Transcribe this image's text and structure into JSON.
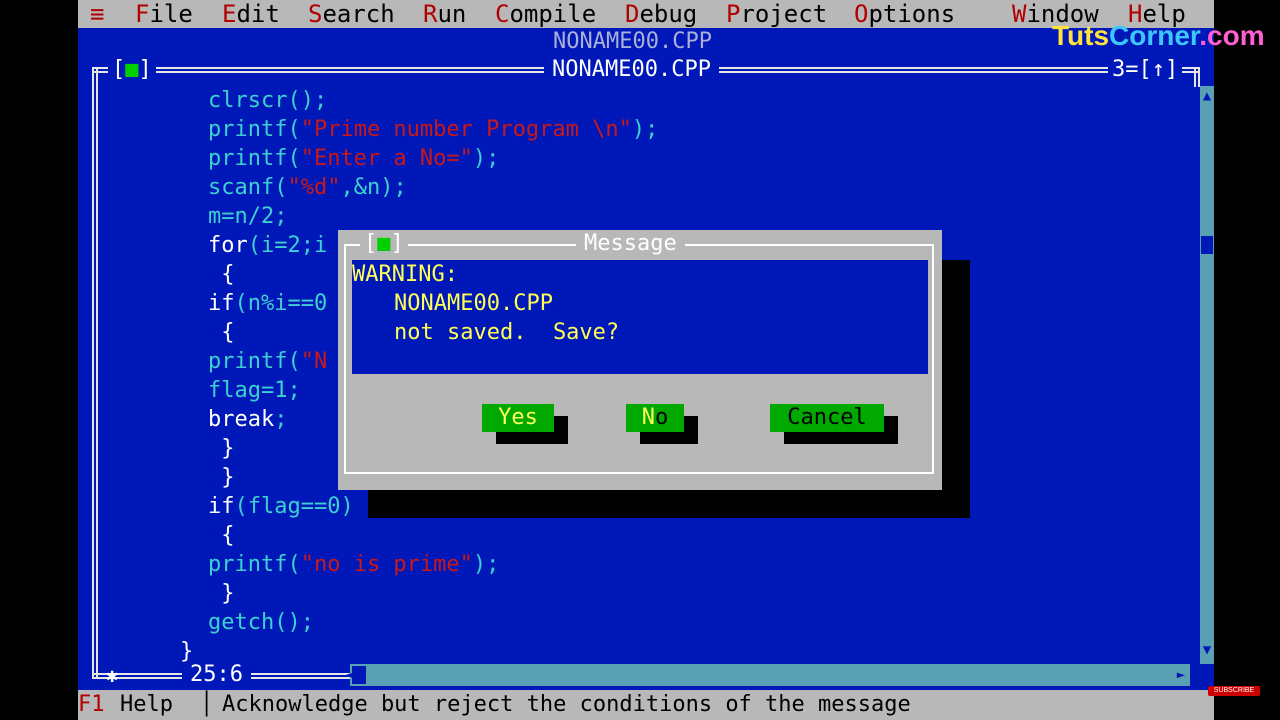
{
  "menu": {
    "system": "≡",
    "items": [
      {
        "hot": "F",
        "rest": "ile"
      },
      {
        "hot": "E",
        "rest": "dit"
      },
      {
        "hot": "S",
        "rest": "earch"
      },
      {
        "hot": "R",
        "rest": "un"
      },
      {
        "hot": "C",
        "rest": "ompile"
      },
      {
        "hot": "D",
        "rest": "ebug"
      },
      {
        "hot": "P",
        "rest": "roject"
      },
      {
        "hot": "O",
        "rest": "ptions"
      },
      {
        "hot": "W",
        "rest": "indow"
      },
      {
        "hot": "H",
        "rest": "elp"
      }
    ]
  },
  "background_window": {
    "title": "NONAME00.CPP"
  },
  "editor": {
    "title": "NONAME00.CPP",
    "close_box": "[",
    "close_box_mark": "■",
    "close_box_end": "]",
    "window_number": "3=[↑]",
    "cursor_position": "25:6",
    "lines": [
      [
        {
          "t": "clrscr();",
          "c": "c"
        }
      ],
      [
        {
          "t": "printf(",
          "c": "c"
        },
        {
          "t": "\"Prime number Program \\n\"",
          "c": "s"
        },
        {
          "t": ");",
          "c": "c"
        }
      ],
      [
        {
          "t": "printf(",
          "c": "c"
        },
        {
          "t": "\"Enter a No=\"",
          "c": "s"
        },
        {
          "t": ");",
          "c": "c"
        }
      ],
      [
        {
          "t": "scanf(",
          "c": "c"
        },
        {
          "t": "\"%d\"",
          "c": "s"
        },
        {
          "t": ",&n);",
          "c": "c"
        }
      ],
      [
        {
          "t": "m=n/2;",
          "c": "c"
        }
      ],
      [
        {
          "t": "for",
          "c": "w"
        },
        {
          "t": "(i=2;i",
          "c": "c"
        }
      ],
      [
        {
          "t": " {",
          "c": "w"
        }
      ],
      [
        {
          "t": "if",
          "c": "w"
        },
        {
          "t": "(n%i==0",
          "c": "c"
        }
      ],
      [
        {
          "t": " {",
          "c": "w"
        }
      ],
      [
        {
          "t": "printf(",
          "c": "c"
        },
        {
          "t": "\"N",
          "c": "s"
        }
      ],
      [
        {
          "t": "flag=1;",
          "c": "c"
        }
      ],
      [
        {
          "t": "break",
          "c": "w"
        },
        {
          "t": ";",
          "c": "c"
        }
      ],
      [
        {
          "t": " }",
          "c": "w"
        }
      ],
      [
        {
          "t": " }",
          "c": "w"
        }
      ],
      [
        {
          "t": "if",
          "c": "w"
        },
        {
          "t": "(flag==0)",
          "c": "c"
        }
      ],
      [
        {
          "t": " {",
          "c": "w"
        }
      ],
      [
        {
          "t": "printf(",
          "c": "c"
        },
        {
          "t": "\"no is prime\"",
          "c": "s"
        },
        {
          "t": ");",
          "c": "c"
        }
      ],
      [
        {
          "t": " }",
          "c": "w"
        }
      ],
      [
        {
          "t": "getch();",
          "c": "c"
        }
      ],
      [
        {
          "t": "}",
          "c": "w",
          "indent": -7
        }
      ]
    ]
  },
  "dialog": {
    "title": "Message",
    "close_box": "[",
    "close_box_mark": "■",
    "close_box_end": "]",
    "warning": "WARNING:",
    "filename": "NONAME00.CPP",
    "question": "not saved.  Save?",
    "buttons": {
      "yes": {
        "hot": "Y",
        "rest": "es"
      },
      "no": {
        "hot": "N",
        "rest": "o"
      },
      "cancel": {
        "label": "Cancel"
      }
    }
  },
  "statusbar": {
    "key": "F1",
    "key_label": "Help",
    "separator": "│",
    "message": "Acknowledge but reject the conditions of the message"
  },
  "watermark": {
    "part1": "Tuts",
    "part2": "Corner",
    "part3": ".com"
  },
  "subscribe_badge": "SUBSCRIBE",
  "colors": {
    "editor_bg": "#0018b8",
    "menu_bg": "#b8b8b8",
    "button_bg": "#00a800",
    "highlight_text": "#ffff55",
    "string_text": "#c81818",
    "code_text": "#3cd0d0"
  }
}
